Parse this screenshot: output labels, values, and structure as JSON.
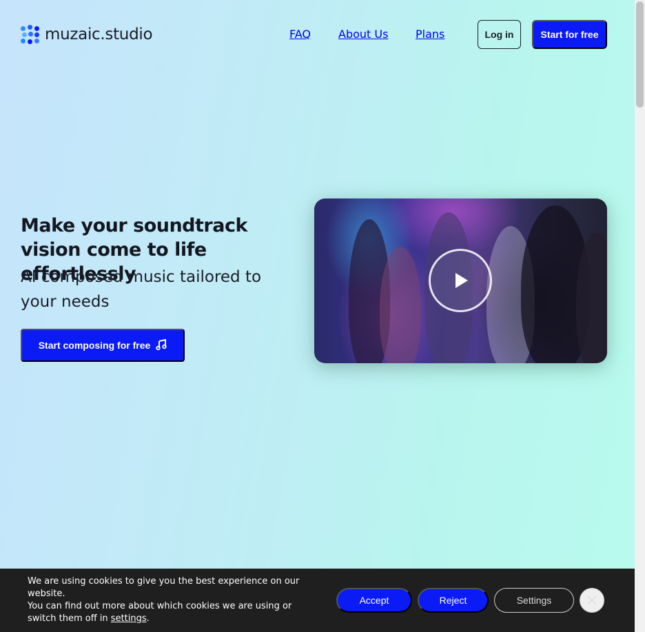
{
  "brand": {
    "name": "muzaic.studio",
    "accent": "#0a1bf5"
  },
  "nav": {
    "items": [
      {
        "label": "FAQ"
      },
      {
        "label": "About Us"
      },
      {
        "label": "Plans"
      }
    ],
    "login_label": "Log in",
    "start_label": "Start for free"
  },
  "hero": {
    "title": "Make your soundtrack vision come to life effortlessly",
    "subtitle": "AI composed music tailored to your needs",
    "cta_label": "Start composing for free",
    "cta_icon": "music-note-icon"
  },
  "video": {
    "play_icon": "play-icon"
  },
  "cookie": {
    "line1": "We are using cookies to give you the best experience on our website.",
    "line2_prefix": "You can find out more about which cookies we are using or switch them off in ",
    "settings_link": "settings",
    "line2_suffix": ".",
    "accept_label": "Accept",
    "reject_label": "Reject",
    "settings_label": "Settings",
    "close_icon": "close-icon"
  }
}
